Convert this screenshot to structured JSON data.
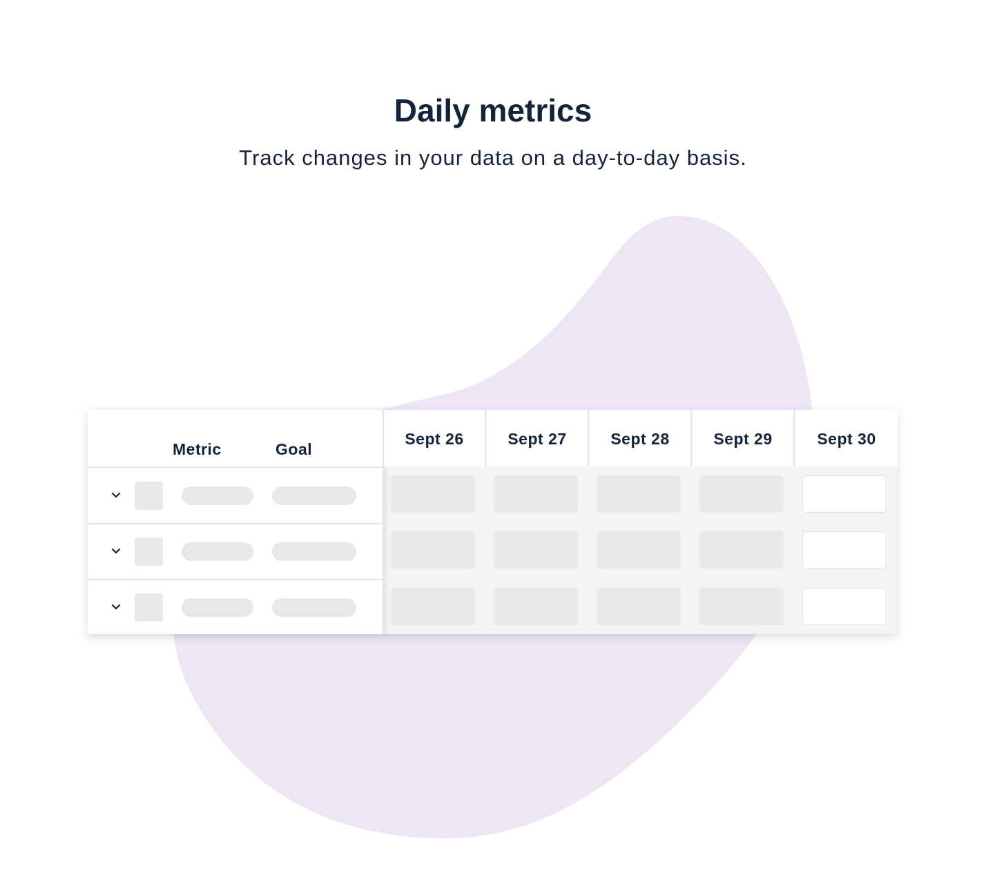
{
  "header": {
    "title": "Daily metrics",
    "subtitle": "Track changes in your data on a day-to-day basis."
  },
  "colors": {
    "blob": "#ede6f5",
    "text": "#13243a",
    "placeholder": "#e6e8ea",
    "grid_background": "#f4f4f4"
  },
  "table": {
    "columns": {
      "metric": "Metric",
      "goal": "Goal"
    },
    "days": [
      "Sept 26",
      "Sept 27",
      "Sept 28",
      "Sept 29",
      "Sept 30"
    ],
    "rows": [
      {
        "expand_icon": "chevron-down-icon"
      },
      {
        "expand_icon": "chevron-down-icon"
      },
      {
        "expand_icon": "chevron-down-icon"
      }
    ]
  }
}
